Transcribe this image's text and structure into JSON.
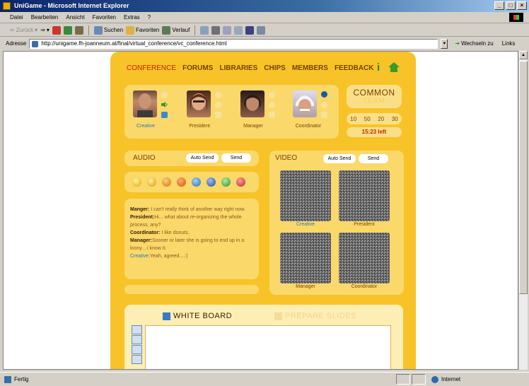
{
  "window": {
    "title": "UniGame - Microsoft Internet Explorer",
    "btn_min": "_",
    "btn_max": "□",
    "btn_close": "×"
  },
  "menu": [
    "Datei",
    "Bearbeiten",
    "Ansicht",
    "Favoriten",
    "Extras",
    "?"
  ],
  "toolbar": {
    "back": "Zurück",
    "search": "Suchen",
    "favorites": "Favoriten",
    "history": "Verlauf"
  },
  "address": {
    "label": "Adresse",
    "url": "http://unigame.fh-joanneum.at/final/virtual_conference/vc_conference.html",
    "go": "Wechseln zu",
    "links": "Links"
  },
  "status": {
    "left": "Fertig",
    "zone": "Internet"
  },
  "nav": [
    {
      "label": "CONFERENCE",
      "active": true
    },
    {
      "label": "FORUMS"
    },
    {
      "label": "LIBRARIES"
    },
    {
      "label": "CHIPS"
    },
    {
      "label": "MEMBERS"
    },
    {
      "label": "FEEDBACK"
    }
  ],
  "participants": [
    {
      "name": "Creative",
      "self": true
    },
    {
      "name": "President"
    },
    {
      "name": "Manager"
    },
    {
      "name": "Coordinator"
    }
  ],
  "team": {
    "title": "COMMON",
    "subtitle": "TEAM",
    "timer_options": [
      "10",
      "50",
      "20",
      "30"
    ],
    "time_left": "15:23 left"
  },
  "audio": {
    "title": "AUDIO",
    "auto_send": "Auto Send",
    "send": "Send"
  },
  "video": {
    "title": "VIDEO",
    "auto_send": "Auto Send",
    "send": "Send",
    "tiles": [
      "Creative",
      "President",
      "Manager",
      "Coordinator"
    ]
  },
  "chat": [
    {
      "who": "Manger:",
      "text": " I can't really think of another way right now."
    },
    {
      "who": "President:",
      "text": "Hi... what about re-organizing the whole process, any?"
    },
    {
      "who": "Coordinator:",
      "text": " I like donuts."
    },
    {
      "who": "Manager:",
      "text": "Sooner or later she is going to end up in a loony... i know it."
    },
    {
      "who": "Creative:",
      "text": "Yeah, agreed....:)",
      "self": true
    }
  ],
  "whiteboard": {
    "title": "WHITE BOARD",
    "prepare": "PREPARE SLIDES"
  },
  "colors": {
    "page_bg": "#f7c328",
    "panel": "#fbd86a",
    "nav_text": "#7a4300",
    "nav_active": "#d02000",
    "self_blue": "#2a7ab0"
  }
}
